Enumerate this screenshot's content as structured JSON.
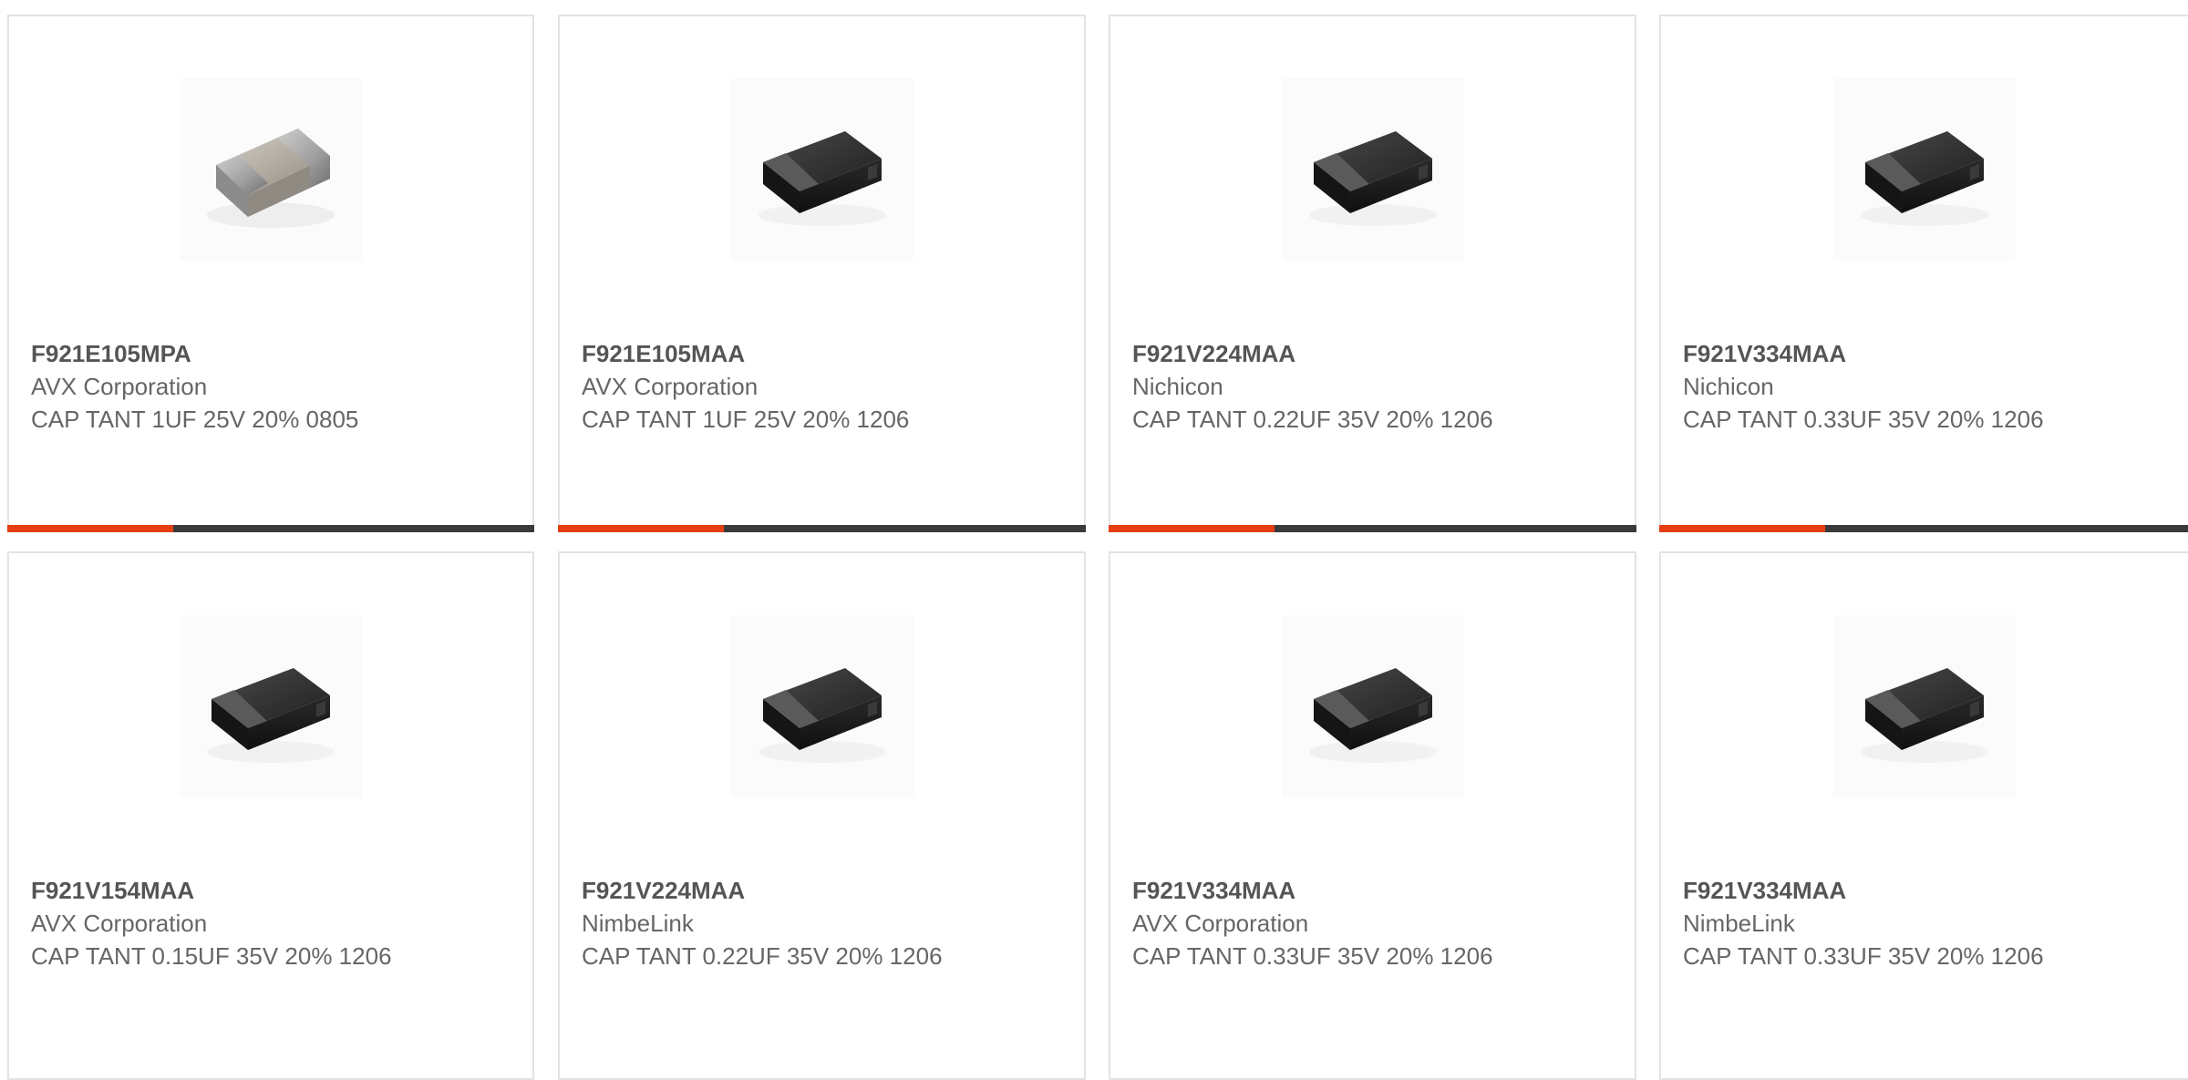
{
  "colors": {
    "accent": "#e63e12",
    "bar_base": "#3a3a3a",
    "border": "#e3e3e3",
    "text": "#666666"
  },
  "products": [
    {
      "part_number": "F921E105MPA",
      "manufacturer": "AVX Corporation",
      "description": "CAP TANT 1UF 25V 20% 0805",
      "image_icon": "ceramic-chip-capacitor-icon"
    },
    {
      "part_number": "F921E105MAA",
      "manufacturer": "AVX Corporation",
      "description": "CAP TANT 1UF 25V 20% 1206",
      "image_icon": "tantalum-capacitor-icon"
    },
    {
      "part_number": "F921V224MAA",
      "manufacturer": "Nichicon",
      "description": "CAP TANT 0.22UF 35V 20% 1206",
      "image_icon": "tantalum-capacitor-icon"
    },
    {
      "part_number": "F921V334MAA",
      "manufacturer": "Nichicon",
      "description": "CAP TANT 0.33UF 35V 20% 1206",
      "image_icon": "tantalum-capacitor-icon"
    },
    {
      "part_number": "F921V154MAA",
      "manufacturer": "AVX Corporation",
      "description": "CAP TANT 0.15UF 35V 20% 1206",
      "image_icon": "tantalum-capacitor-icon"
    },
    {
      "part_number": "F921V224MAA",
      "manufacturer": "NimbeLink",
      "description": "CAP TANT 0.22UF 35V 20% 1206",
      "image_icon": "tantalum-capacitor-icon"
    },
    {
      "part_number": "F921V334MAA",
      "manufacturer": "AVX Corporation",
      "description": "CAP TANT 0.33UF 35V 20% 1206",
      "image_icon": "tantalum-capacitor-icon"
    },
    {
      "part_number": "F921V334MAA",
      "manufacturer": "NimbeLink",
      "description": "CAP TANT 0.33UF 35V 20% 1206",
      "image_icon": "tantalum-capacitor-icon"
    }
  ]
}
